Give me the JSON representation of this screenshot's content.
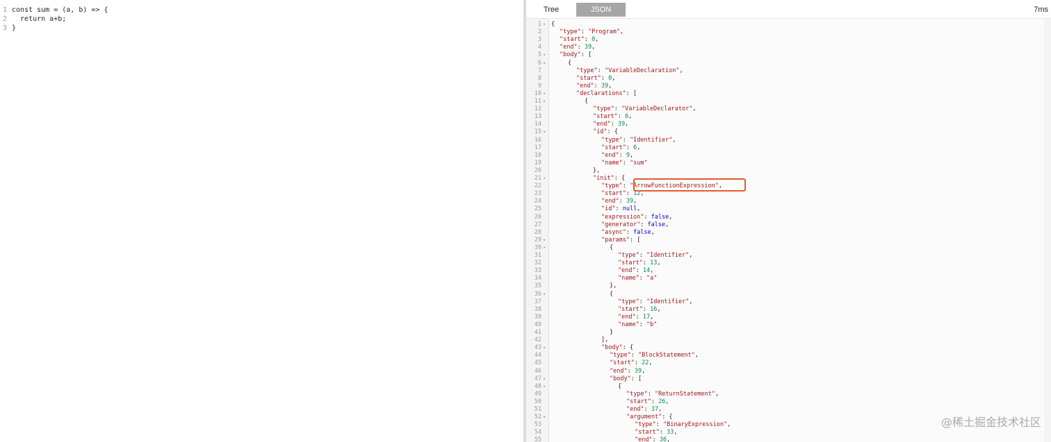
{
  "editor": {
    "lines": [
      {
        "num": "1",
        "text": "const sum = (a, b) => {"
      },
      {
        "num": "2",
        "text": "  return a+b;"
      },
      {
        "num": "3",
        "text": "}"
      }
    ]
  },
  "tabs": {
    "tree_label": "Tree",
    "json_label": "JSON",
    "active": "JSON"
  },
  "timing": "7ms",
  "json_lines": [
    {
      "num": "1",
      "fold": true,
      "indent": 0,
      "parts": [
        [
          "p",
          "{"
        ]
      ]
    },
    {
      "num": "2",
      "fold": false,
      "indent": 1,
      "parts": [
        [
          "k",
          "\"type\""
        ],
        [
          "p",
          ": "
        ],
        [
          "s",
          "\"Program\""
        ],
        [
          "p",
          ","
        ]
      ]
    },
    {
      "num": "3",
      "fold": false,
      "indent": 1,
      "parts": [
        [
          "k",
          "\"start\""
        ],
        [
          "p",
          ": "
        ],
        [
          "n",
          "0"
        ],
        [
          "p",
          ","
        ]
      ]
    },
    {
      "num": "4",
      "fold": false,
      "indent": 1,
      "parts": [
        [
          "k",
          "\"end\""
        ],
        [
          "p",
          ": "
        ],
        [
          "n",
          "39"
        ],
        [
          "p",
          ","
        ]
      ]
    },
    {
      "num": "5",
      "fold": true,
      "indent": 1,
      "parts": [
        [
          "k",
          "\"body\""
        ],
        [
          "p",
          ": ["
        ]
      ]
    },
    {
      "num": "6",
      "fold": true,
      "indent": 2,
      "parts": [
        [
          "p",
          "{"
        ]
      ]
    },
    {
      "num": "7",
      "fold": false,
      "indent": 3,
      "parts": [
        [
          "k",
          "\"type\""
        ],
        [
          "p",
          ": "
        ],
        [
          "s",
          "\"VariableDeclaration\""
        ],
        [
          "p",
          ","
        ]
      ]
    },
    {
      "num": "8",
      "fold": false,
      "indent": 3,
      "parts": [
        [
          "k",
          "\"start\""
        ],
        [
          "p",
          ": "
        ],
        [
          "n",
          "0"
        ],
        [
          "p",
          ","
        ]
      ]
    },
    {
      "num": "9",
      "fold": false,
      "indent": 3,
      "parts": [
        [
          "k",
          "\"end\""
        ],
        [
          "p",
          ": "
        ],
        [
          "n",
          "39"
        ],
        [
          "p",
          ","
        ]
      ]
    },
    {
      "num": "10",
      "fold": true,
      "indent": 3,
      "parts": [
        [
          "k",
          "\"declarations\""
        ],
        [
          "p",
          ": ["
        ]
      ]
    },
    {
      "num": "11",
      "fold": true,
      "indent": 4,
      "parts": [
        [
          "p",
          "{"
        ]
      ]
    },
    {
      "num": "12",
      "fold": false,
      "indent": 5,
      "parts": [
        [
          "k",
          "\"type\""
        ],
        [
          "p",
          ": "
        ],
        [
          "s",
          "\"VariableDeclarator\""
        ],
        [
          "p",
          ","
        ]
      ]
    },
    {
      "num": "13",
      "fold": false,
      "indent": 5,
      "parts": [
        [
          "k",
          "\"start\""
        ],
        [
          "p",
          ": "
        ],
        [
          "n",
          "6"
        ],
        [
          "p",
          ","
        ]
      ]
    },
    {
      "num": "14",
      "fold": false,
      "indent": 5,
      "parts": [
        [
          "k",
          "\"end\""
        ],
        [
          "p",
          ": "
        ],
        [
          "n",
          "39"
        ],
        [
          "p",
          ","
        ]
      ]
    },
    {
      "num": "15",
      "fold": true,
      "indent": 5,
      "parts": [
        [
          "k",
          "\"id\""
        ],
        [
          "p",
          ": {"
        ]
      ]
    },
    {
      "num": "16",
      "fold": false,
      "indent": 6,
      "parts": [
        [
          "k",
          "\"type\""
        ],
        [
          "p",
          ": "
        ],
        [
          "s",
          "\"Identifier\""
        ],
        [
          "p",
          ","
        ]
      ]
    },
    {
      "num": "17",
      "fold": false,
      "indent": 6,
      "parts": [
        [
          "k",
          "\"start\""
        ],
        [
          "p",
          ": "
        ],
        [
          "n",
          "6"
        ],
        [
          "p",
          ","
        ]
      ]
    },
    {
      "num": "18",
      "fold": false,
      "indent": 6,
      "parts": [
        [
          "k",
          "\"end\""
        ],
        [
          "p",
          ": "
        ],
        [
          "n",
          "9"
        ],
        [
          "p",
          ","
        ]
      ]
    },
    {
      "num": "19",
      "fold": false,
      "indent": 6,
      "parts": [
        [
          "k",
          "\"name\""
        ],
        [
          "p",
          ": "
        ],
        [
          "s",
          "\"sum\""
        ]
      ]
    },
    {
      "num": "20",
      "fold": false,
      "indent": 5,
      "parts": [
        [
          "p",
          "},"
        ]
      ]
    },
    {
      "num": "21",
      "fold": true,
      "indent": 5,
      "parts": [
        [
          "k",
          "\"init\""
        ],
        [
          "p",
          ": {"
        ]
      ]
    },
    {
      "num": "22",
      "fold": false,
      "indent": 6,
      "parts": [
        [
          "k",
          "\"type\""
        ],
        [
          "p",
          ": "
        ],
        [
          "s",
          "\"ArrowFunctionExpression\""
        ],
        [
          "p",
          ","
        ]
      ]
    },
    {
      "num": "23",
      "fold": false,
      "indent": 6,
      "parts": [
        [
          "k",
          "\"start\""
        ],
        [
          "p",
          ": "
        ],
        [
          "n",
          "12"
        ],
        [
          "p",
          ","
        ]
      ]
    },
    {
      "num": "24",
      "fold": false,
      "indent": 6,
      "parts": [
        [
          "k",
          "\"end\""
        ],
        [
          "p",
          ": "
        ],
        [
          "n",
          "39"
        ],
        [
          "p",
          ","
        ]
      ]
    },
    {
      "num": "25",
      "fold": false,
      "indent": 6,
      "parts": [
        [
          "k",
          "\"id\""
        ],
        [
          "p",
          ": "
        ],
        [
          "kw",
          "null"
        ],
        [
          "p",
          ","
        ]
      ]
    },
    {
      "num": "26",
      "fold": false,
      "indent": 6,
      "parts": [
        [
          "k",
          "\"expression\""
        ],
        [
          "p",
          ": "
        ],
        [
          "kw",
          "false"
        ],
        [
          "p",
          ","
        ]
      ]
    },
    {
      "num": "27",
      "fold": false,
      "indent": 6,
      "parts": [
        [
          "k",
          "\"generator\""
        ],
        [
          "p",
          ": "
        ],
        [
          "kw",
          "false"
        ],
        [
          "p",
          ","
        ]
      ]
    },
    {
      "num": "28",
      "fold": false,
      "indent": 6,
      "parts": [
        [
          "k",
          "\"async\""
        ],
        [
          "p",
          ": "
        ],
        [
          "kw",
          "false"
        ],
        [
          "p",
          ","
        ]
      ]
    },
    {
      "num": "29",
      "fold": true,
      "indent": 6,
      "parts": [
        [
          "k",
          "\"params\""
        ],
        [
          "p",
          ": ["
        ]
      ]
    },
    {
      "num": "30",
      "fold": true,
      "indent": 7,
      "parts": [
        [
          "p",
          "{"
        ]
      ]
    },
    {
      "num": "31",
      "fold": false,
      "indent": 8,
      "parts": [
        [
          "k",
          "\"type\""
        ],
        [
          "p",
          ": "
        ],
        [
          "s",
          "\"Identifier\""
        ],
        [
          "p",
          ","
        ]
      ]
    },
    {
      "num": "32",
      "fold": false,
      "indent": 8,
      "parts": [
        [
          "k",
          "\"start\""
        ],
        [
          "p",
          ": "
        ],
        [
          "n",
          "13"
        ],
        [
          "p",
          ","
        ]
      ]
    },
    {
      "num": "33",
      "fold": false,
      "indent": 8,
      "parts": [
        [
          "k",
          "\"end\""
        ],
        [
          "p",
          ": "
        ],
        [
          "n",
          "14"
        ],
        [
          "p",
          ","
        ]
      ]
    },
    {
      "num": "34",
      "fold": false,
      "indent": 8,
      "parts": [
        [
          "k",
          "\"name\""
        ],
        [
          "p",
          ": "
        ],
        [
          "s",
          "\"a\""
        ]
      ]
    },
    {
      "num": "35",
      "fold": false,
      "indent": 7,
      "parts": [
        [
          "p",
          "},"
        ]
      ]
    },
    {
      "num": "36",
      "fold": true,
      "indent": 7,
      "parts": [
        [
          "p",
          "{"
        ]
      ]
    },
    {
      "num": "37",
      "fold": false,
      "indent": 8,
      "parts": [
        [
          "k",
          "\"type\""
        ],
        [
          "p",
          ": "
        ],
        [
          "s",
          "\"Identifier\""
        ],
        [
          "p",
          ","
        ]
      ]
    },
    {
      "num": "38",
      "fold": false,
      "indent": 8,
      "parts": [
        [
          "k",
          "\"start\""
        ],
        [
          "p",
          ": "
        ],
        [
          "n",
          "16"
        ],
        [
          "p",
          ","
        ]
      ]
    },
    {
      "num": "39",
      "fold": false,
      "indent": 8,
      "parts": [
        [
          "k",
          "\"end\""
        ],
        [
          "p",
          ": "
        ],
        [
          "n",
          "17"
        ],
        [
          "p",
          ","
        ]
      ]
    },
    {
      "num": "40",
      "fold": false,
      "indent": 8,
      "parts": [
        [
          "k",
          "\"name\""
        ],
        [
          "p",
          ": "
        ],
        [
          "s",
          "\"b\""
        ]
      ]
    },
    {
      "num": "41",
      "fold": false,
      "indent": 7,
      "parts": [
        [
          "p",
          "}"
        ]
      ]
    },
    {
      "num": "42",
      "fold": false,
      "indent": 6,
      "parts": [
        [
          "p",
          "],"
        ]
      ]
    },
    {
      "num": "43",
      "fold": true,
      "indent": 6,
      "parts": [
        [
          "k",
          "\"body\""
        ],
        [
          "p",
          ": {"
        ]
      ]
    },
    {
      "num": "44",
      "fold": false,
      "indent": 7,
      "parts": [
        [
          "k",
          "\"type\""
        ],
        [
          "p",
          ": "
        ],
        [
          "s",
          "\"BlockStatement\""
        ],
        [
          "p",
          ","
        ]
      ]
    },
    {
      "num": "45",
      "fold": false,
      "indent": 7,
      "parts": [
        [
          "k",
          "\"start\""
        ],
        [
          "p",
          ": "
        ],
        [
          "n",
          "22"
        ],
        [
          "p",
          ","
        ]
      ]
    },
    {
      "num": "46",
      "fold": false,
      "indent": 7,
      "parts": [
        [
          "k",
          "\"end\""
        ],
        [
          "p",
          ": "
        ],
        [
          "n",
          "39"
        ],
        [
          "p",
          ","
        ]
      ]
    },
    {
      "num": "47",
      "fold": true,
      "indent": 7,
      "parts": [
        [
          "k",
          "\"body\""
        ],
        [
          "p",
          ": ["
        ]
      ]
    },
    {
      "num": "48",
      "fold": true,
      "indent": 8,
      "parts": [
        [
          "p",
          "{"
        ]
      ]
    },
    {
      "num": "49",
      "fold": false,
      "indent": 9,
      "parts": [
        [
          "k",
          "\"type\""
        ],
        [
          "p",
          ": "
        ],
        [
          "s",
          "\"ReturnStatement\""
        ],
        [
          "p",
          ","
        ]
      ]
    },
    {
      "num": "50",
      "fold": false,
      "indent": 9,
      "parts": [
        [
          "k",
          "\"start\""
        ],
        [
          "p",
          ": "
        ],
        [
          "n",
          "26"
        ],
        [
          "p",
          ","
        ]
      ]
    },
    {
      "num": "51",
      "fold": false,
      "indent": 9,
      "parts": [
        [
          "k",
          "\"end\""
        ],
        [
          "p",
          ": "
        ],
        [
          "n",
          "37"
        ],
        [
          "p",
          ","
        ]
      ]
    },
    {
      "num": "52",
      "fold": true,
      "indent": 9,
      "parts": [
        [
          "k",
          "\"argument\""
        ],
        [
          "p",
          ": {"
        ]
      ]
    },
    {
      "num": "53",
      "fold": false,
      "indent": 10,
      "parts": [
        [
          "k",
          "\"type\""
        ],
        [
          "p",
          ": "
        ],
        [
          "s",
          "\"BinaryExpression\""
        ],
        [
          "p",
          ","
        ]
      ]
    },
    {
      "num": "54",
      "fold": false,
      "indent": 10,
      "parts": [
        [
          "k",
          "\"start\""
        ],
        [
          "p",
          ": "
        ],
        [
          "n",
          "33"
        ],
        [
          "p",
          ","
        ]
      ]
    },
    {
      "num": "55",
      "fold": false,
      "indent": 10,
      "parts": [
        [
          "k",
          "\"end\""
        ],
        [
          "p",
          ": "
        ],
        [
          "n",
          "36"
        ],
        [
          "p",
          ","
        ]
      ]
    }
  ],
  "highlighted_line": "22",
  "watermark": "@稀土掘金技术社区",
  "colors": {
    "json_key": "#a31515",
    "json_string": "#a31515",
    "json_number": "#098658",
    "json_keyword": "#0000cc",
    "highlight_border": "#e05a28",
    "active_tab_bg": "#a6a6a6"
  }
}
